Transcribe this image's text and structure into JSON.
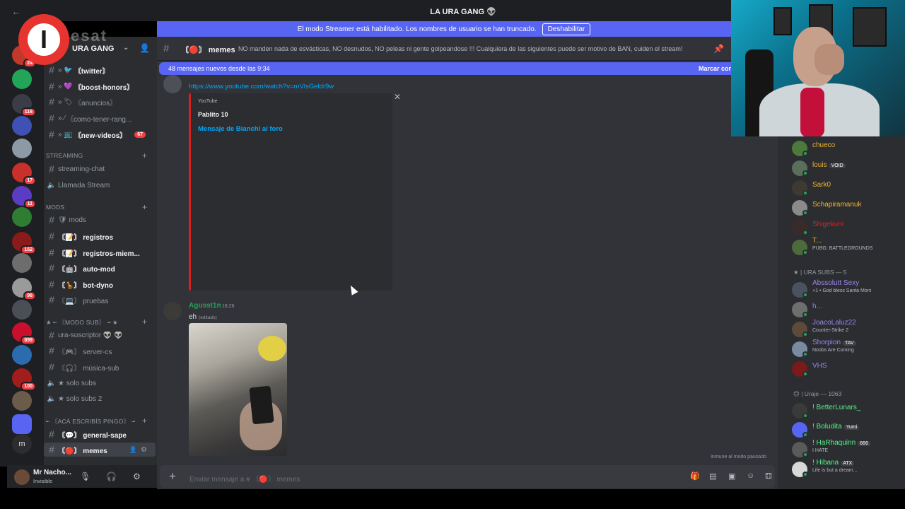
{
  "window": {
    "title": "LA URA GANG 👽"
  },
  "streamer_banner": {
    "text": "El modo Streamer está habilitado. Los nombres de usuario se han truncado.",
    "button": "Deshabilitar"
  },
  "logo": {
    "letter": "I",
    "text": "esat"
  },
  "server": {
    "name": "URA GANG"
  },
  "server_rail": {
    "icons": [
      {
        "color": "#c0392b",
        "badge": "24"
      },
      {
        "color": "#23a559",
        "badge": ""
      },
      {
        "color": "#3a3d45",
        "badge": "116"
      },
      {
        "color": "#3f51b5",
        "badge": ""
      },
      {
        "color": "#8d9aa6",
        "badge": ""
      },
      {
        "color": "#c9302c",
        "badge": "17"
      },
      {
        "color": "#5b3cc4",
        "badge": "11"
      },
      {
        "color": "#2f7d32",
        "badge": ""
      },
      {
        "color": "#8b1a1a",
        "badge": "152"
      },
      {
        "color": "#6d6d6d",
        "badge": ""
      },
      {
        "color": "#9a9a9a",
        "badge": "96"
      },
      {
        "color": "#4a4e57",
        "badge": ""
      },
      {
        "color": "#c8102e",
        "badge": "899"
      },
      {
        "color": "#2b6cb0",
        "badge": ""
      },
      {
        "color": "#a31d1d",
        "badge": "100"
      },
      {
        "color": "#6b5b4b",
        "badge": ""
      }
    ]
  },
  "channels": {
    "items": [
      {
        "label": "〘twitter〙",
        "prefix": "» 🐦",
        "bright": true,
        "badge": ""
      },
      {
        "label": "〘boost-honors〙",
        "prefix": "» 💜",
        "bright": true,
        "badge": ""
      },
      {
        "label": "〘anuncios〙",
        "prefix": "» 🏷",
        "bright": false,
        "badge": ""
      },
      {
        "label": "〘como-tener-rang...",
        "prefix": "» ⁄",
        "bright": false,
        "badge": ""
      },
      {
        "label": "〘new-videos〙",
        "prefix": "» 📺",
        "bright": true,
        "badge": "67"
      }
    ],
    "categories": {
      "streaming": "STREAMING",
      "mods": "mods",
      "modo_sub": "★ ╾ 〘MODO SUB〙 ╼ ★",
      "aca": "╾ 〘acá escribís pingo〙 ╼"
    },
    "streaming_items": [
      {
        "label": "streaming-chat"
      },
      {
        "label": "Llamada Stream"
      }
    ],
    "mods_items": [
      {
        "label": "🛡 mods",
        "bright": false
      },
      {
        "label": "〘📝〙 registros",
        "bright": true
      },
      {
        "label": "〘📝〙 registros-miem...",
        "bright": true
      },
      {
        "label": "〘🤖〙 auto-mod",
        "bright": true
      },
      {
        "label": "〘🦒〙 bot-dyno",
        "bright": true
      },
      {
        "label": "〘💻〙 pruebas",
        "bright": false
      }
    ],
    "sub_items": [
      {
        "label": "ura-suscriptor 👽 👽"
      },
      {
        "label": "〘🎮〙 server-cs"
      },
      {
        "label": "〘🎧〙 música-sub"
      },
      {
        "label": "★ solo subs"
      },
      {
        "label": "★ solo subs 2"
      }
    ],
    "general_items": [
      {
        "label": "〘💬〙 general-sape"
      },
      {
        "label": "〘🔴〙 memes"
      }
    ]
  },
  "user_panel": {
    "name": "Mr Nacho...",
    "status": "Invisible"
  },
  "chat_header": {
    "channel": "〘🔴〙 memes",
    "topic": "NO manden nada de esvásticas, NO desnudos, NO peleas ni gente golpeandose !!! Cualquiera de las siguientes puede ser motivo de BAN, cuiden el stream!"
  },
  "new_messages": {
    "text": "48 mensajes nuevos desde las 9:34",
    "action": "Marcar cor"
  },
  "messages": [
    {
      "link": "https://www.youtube.com/watch?v=mVlsGeldr9w",
      "embed": {
        "provider": "YouTube",
        "author": "Pablito 10",
        "title": "Mensaje de Bianchi al foro"
      }
    },
    {
      "author": "Agusst1n",
      "time": "16:26",
      "text": "eh",
      "edited": "(editado)"
    }
  ],
  "immune_text": "inmune al modo pausado",
  "composer": {
    "placeholder": "Enviar mensaje a # 〘🔴〙 memes"
  },
  "members": {
    "top": [
      {
        "name": "chueco",
        "color": "#f0b232",
        "status": "",
        "tag": "",
        "avatar": "#4b7a3a"
      },
      {
        "name": "louis",
        "color": "#f0b232",
        "status": "",
        "tag": "VOID",
        "avatar": "#5a6e5a"
      },
      {
        "name": "Sark0",
        "color": "#f0b232",
        "status": "",
        "tag": "",
        "avatar": "#3e3a32"
      },
      {
        "name": "Schapiramanuk",
        "color": "#f0b232",
        "status": "",
        "tag": "",
        "avatar": "#8a8a8a"
      },
      {
        "name": "Shigekuni",
        "color": "#e01e1e",
        "status": "",
        "tag": "",
        "avatar": "#3a2b2b"
      },
      {
        "name": "T...",
        "color": "#f0b232",
        "status": "PUBG: BATTLEGROUNDS",
        "tag": "",
        "avatar": "#4c6a3b"
      }
    ],
    "subs_header": "★ | URA SUBS — 5",
    "subs": [
      {
        "name": "Abssolutt Sexy",
        "color": "#9b84ee",
        "status": "+1 • God bless Santa Moni",
        "tag": "",
        "avatar": "#4a5260"
      },
      {
        "name": "h...",
        "color": "#9b84ee",
        "status": "",
        "tag": "",
        "avatar": "#6e6e6e"
      },
      {
        "name": "JoacoLaluz22",
        "color": "#9b84ee",
        "status": "Counter-Strike 2",
        "tag": "",
        "avatar": "#5c4b3b"
      },
      {
        "name": "Shorpion",
        "color": "#9b84ee",
        "status": "Noobs Are Coming",
        "tag": "TAV",
        "avatar": "#7a8aa0"
      },
      {
        "name": "VHS",
        "color": "#9b84ee",
        "status": "",
        "tag": "",
        "avatar": "#7a1a1a"
      }
    ],
    "uraje_header": "😊 | Uraje — 1063",
    "uraje": [
      {
        "name": "! BetterLunars_",
        "color": "#57f287",
        "status": "",
        "tag": "",
        "avatar": "#3a3a3a"
      },
      {
        "name": "! Boludita",
        "color": "#57f287",
        "status": "",
        "tag": "Yumi",
        "avatar": "#5865f2"
      },
      {
        "name": "! HaRhaquinn",
        "color": "#57f287",
        "status": "I HATE",
        "tag": "666",
        "avatar": "#5a5a5a"
      },
      {
        "name": "! Hibana",
        "color": "#57f287",
        "status": "Life is but a dream...",
        "tag": "ATX",
        "avatar": "#d8d8d8"
      }
    ]
  }
}
